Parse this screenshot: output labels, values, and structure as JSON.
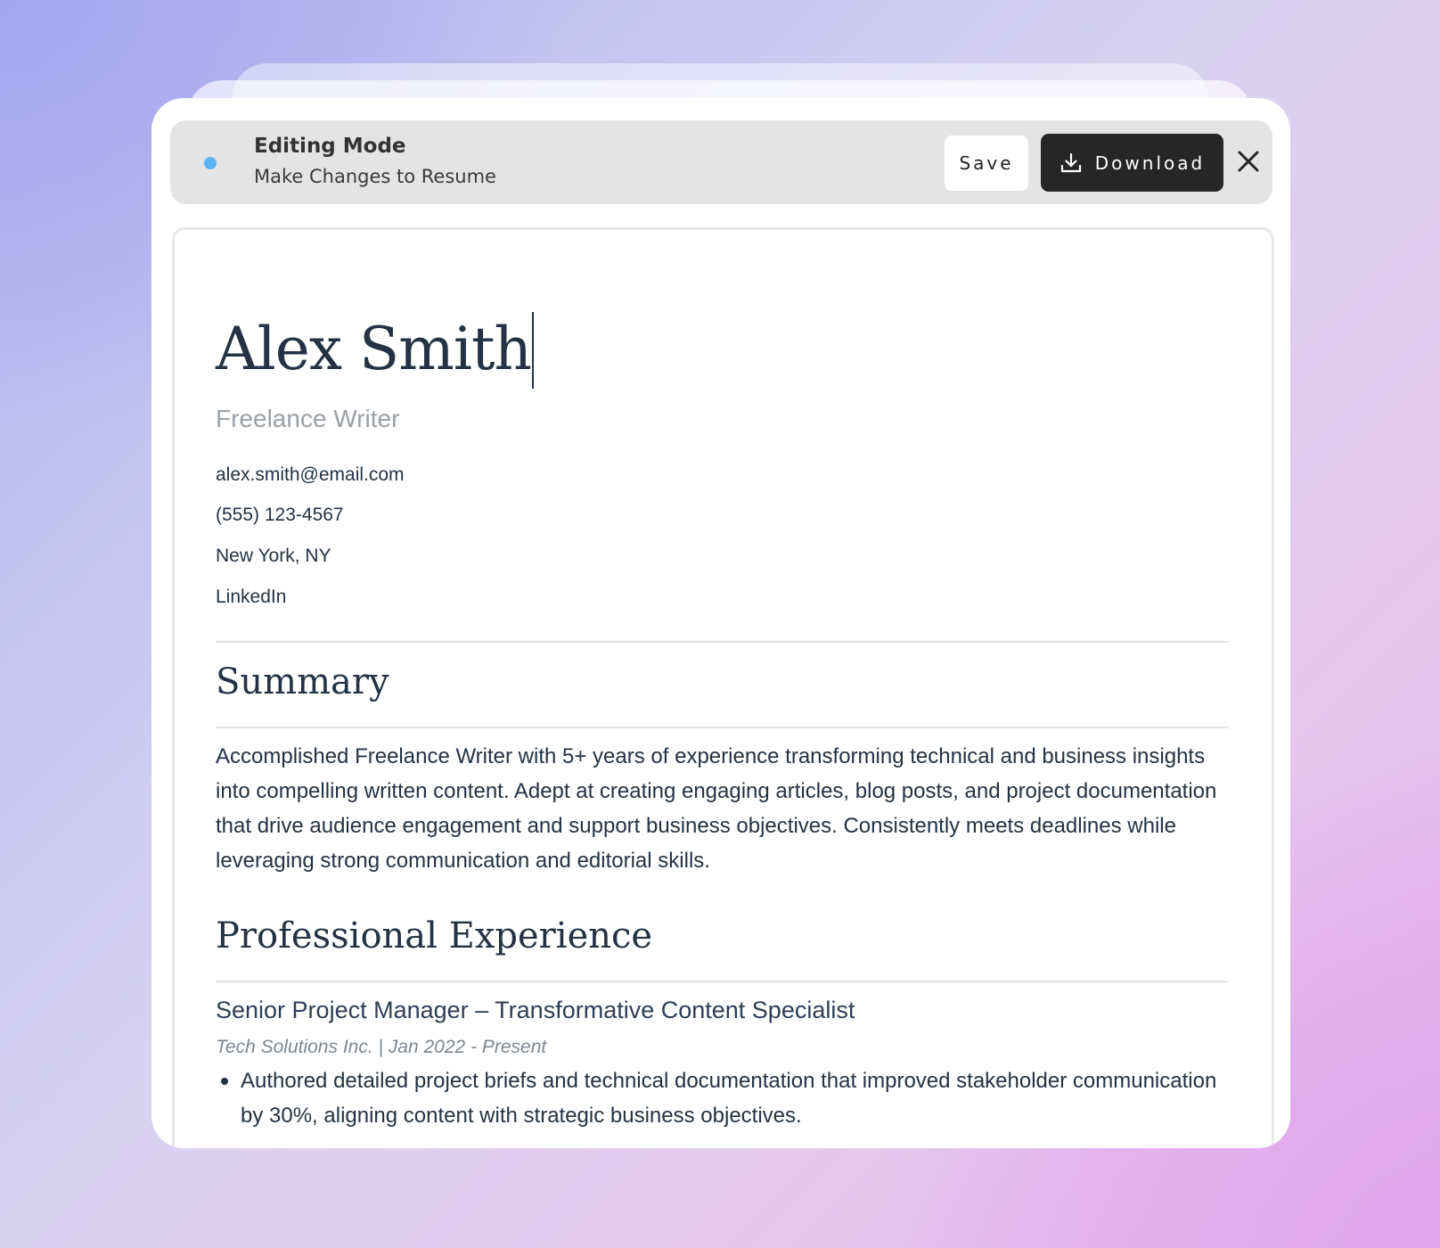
{
  "toolbar": {
    "title": "Editing Mode",
    "subtitle": "Make Changes to Resume",
    "save_label": "Save",
    "download_label": "Download",
    "status_color": "#5fb3f5",
    "icons": {
      "download": "download-icon",
      "close": "close-icon"
    }
  },
  "resume": {
    "name": "Alex Smith",
    "role": "Freelance Writer",
    "contact": {
      "email": "alex.smith@email.com",
      "phone": "(555) 123-4567",
      "location": "New York, NY",
      "linkedin": "LinkedIn"
    },
    "summary": {
      "heading": "Summary",
      "text": "Accomplished Freelance Writer with 5+ years of experience transforming technical and business insights into compelling written content. Adept at creating engaging articles, blog posts, and project documentation that drive audience engagement and support business objectives. Consistently meets deadlines while leveraging strong communication and editorial skills."
    },
    "experience": {
      "heading": "Professional Experience",
      "jobs": [
        {
          "title": "Senior Project Manager – Transformative Content Specialist",
          "meta": "Tech Solutions Inc. | Jan 2022 - Present",
          "bullets": [
            "Authored detailed project briefs and technical documentation that improved stakeholder communication by 30%, aligning content with strategic business objectives."
          ]
        }
      ]
    }
  }
}
